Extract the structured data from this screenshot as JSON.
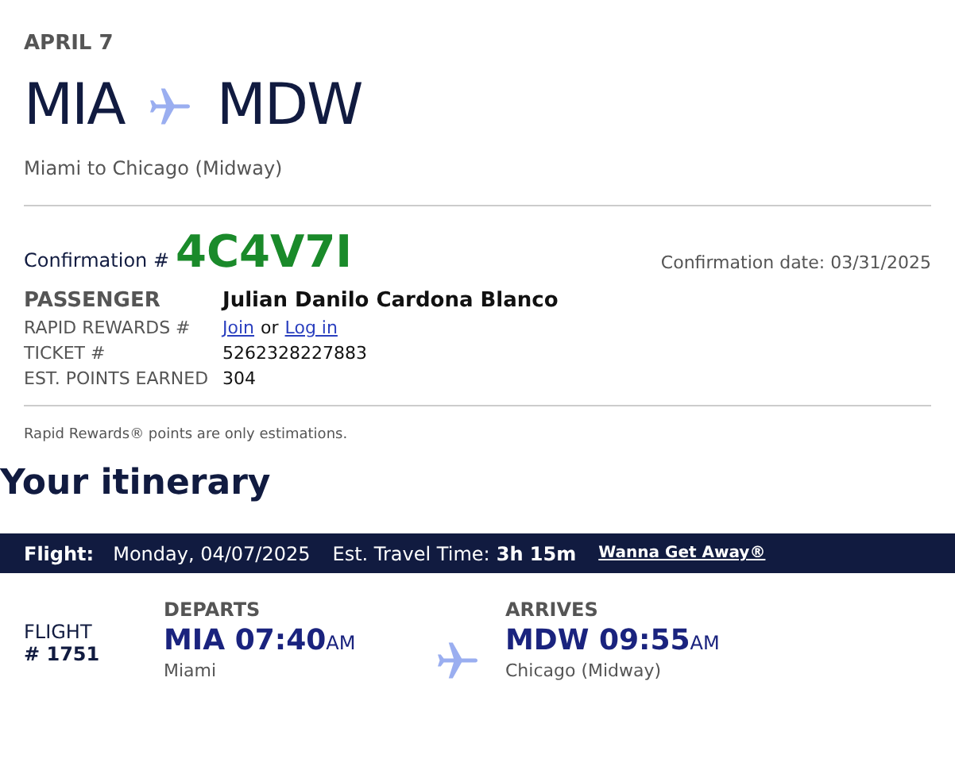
{
  "date": "APRIL 7",
  "route": {
    "origin": "MIA",
    "destination": "MDW",
    "description": "Miami to Chicago (Midway)"
  },
  "confirmation": {
    "label": "Confirmation #",
    "code": "4C4V7I",
    "date_label": "Confirmation date: 03/31/2025"
  },
  "passenger": {
    "label": "PASSENGER",
    "name": "Julian Danilo Cardona Blanco"
  },
  "details": [
    {
      "kind": "links",
      "label": "RAPID REWARDS #",
      "links": [
        "Join",
        "Log in"
      ],
      "joiner": "or"
    },
    {
      "kind": "text",
      "label": "TICKET #",
      "value": "5262328227883"
    },
    {
      "kind": "text",
      "label": "EST. POINTS EARNED",
      "value": "304"
    }
  ],
  "note": "Rapid Rewards® points are only estimations.",
  "itinerary_title": "Your itinerary",
  "flight_bar": {
    "label": "Flight:",
    "date": "Monday, 04/07/2025",
    "travel_label": "Est. Travel Time:",
    "travel_time": "3h 15m",
    "fare_link": "Wanna Get Away®"
  },
  "flight": {
    "label": "FLIGHT",
    "number": "# 1751",
    "departs": {
      "heading": "DEPARTS",
      "airport": "MIA",
      "time": "07:40",
      "period": "AM",
      "city": "Miami"
    },
    "arrives": {
      "heading": "ARRIVES",
      "airport": "MDW",
      "time": "09:55",
      "period": "AM",
      "city": "Chicago (Midway)"
    }
  }
}
